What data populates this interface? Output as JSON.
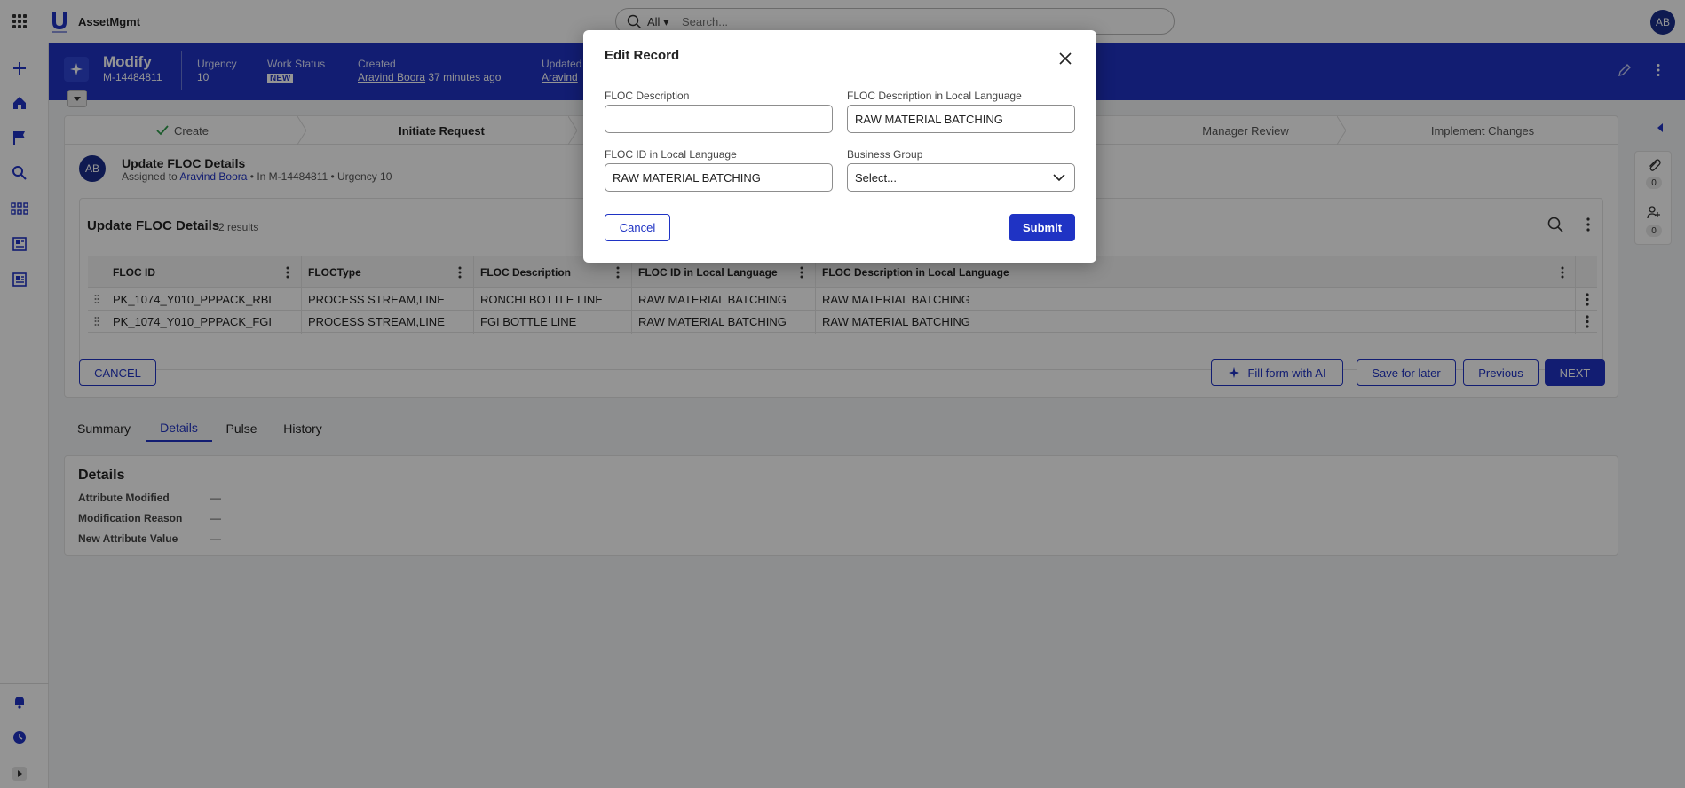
{
  "app": {
    "name": "AssetMgmt",
    "user_initials": "AB"
  },
  "search": {
    "scope": "All",
    "placeholder": "Search..."
  },
  "header": {
    "title": "Modify",
    "record_id": "M-14484811",
    "urgency_label": "Urgency",
    "urgency_value": "10",
    "work_status_label": "Work Status",
    "work_status_value": "NEW",
    "created_label": "Created",
    "created_by": "Aravind Boora",
    "created_ago": "37 minutes ago",
    "updated_label": "Updated",
    "updated_by": "Aravind"
  },
  "steps": [
    {
      "label": "Create",
      "done": true
    },
    {
      "label": "Initiate Request"
    },
    {
      "label": "Manager Review"
    },
    {
      "label": "Implement Changes"
    }
  ],
  "task": {
    "avatar": "AB",
    "title": "Update FLOC Details",
    "assigned_prefix": "Assigned to",
    "assignee": "Aravind Boora",
    "meta": "• In M-14484811 • Urgency 10"
  },
  "table": {
    "title": "Update FLOC Details",
    "count": "2 results",
    "columns": [
      "FLOC ID",
      "FLOCType",
      "FLOC Description",
      "FLOC ID in Local Language",
      "FLOC Description in Local Language"
    ],
    "rows": [
      [
        "PK_1074_Y010_PPPACK_RBL",
        "PROCESS STREAM,LINE",
        "RONCHI BOTTLE LINE",
        "RAW MATERIAL BATCHING",
        "RAW MATERIAL BATCHING"
      ],
      [
        "PK_1074_Y010_PPPACK_FGI",
        "PROCESS STREAM,LINE",
        "FGI BOTTLE LINE",
        "RAW MATERIAL BATCHING",
        "RAW MATERIAL BATCHING"
      ]
    ]
  },
  "actions": {
    "cancel": "CANCEL",
    "fill_ai": "Fill form with AI",
    "save_later": "Save for later",
    "previous": "Previous",
    "next": "NEXT"
  },
  "right_rail": {
    "attachments_count": "0",
    "followers_count": "0"
  },
  "tabs": [
    "Summary",
    "Details",
    "Pulse",
    "History"
  ],
  "details": {
    "title": "Details",
    "fields": [
      {
        "label": "Attribute Modified",
        "value": "—"
      },
      {
        "label": "Modification Reason",
        "value": "—"
      },
      {
        "label": "New Attribute Value",
        "value": "—"
      }
    ]
  },
  "modal": {
    "title": "Edit Record",
    "floc_description_label": "FLOC Description",
    "floc_description_value": "",
    "floc_desc_local_label": "FLOC Description in Local Language",
    "floc_desc_local_value": "RAW MATERIAL BATCHING",
    "floc_id_local_label": "FLOC ID in Local Language",
    "floc_id_local_value": "RAW MATERIAL BATCHING",
    "business_group_label": "Business Group",
    "business_group_value": "Select...",
    "cancel": "Cancel",
    "submit": "Submit"
  },
  "colors": {
    "primary": "#1f33c4",
    "avatar": "#1a2d8c"
  }
}
